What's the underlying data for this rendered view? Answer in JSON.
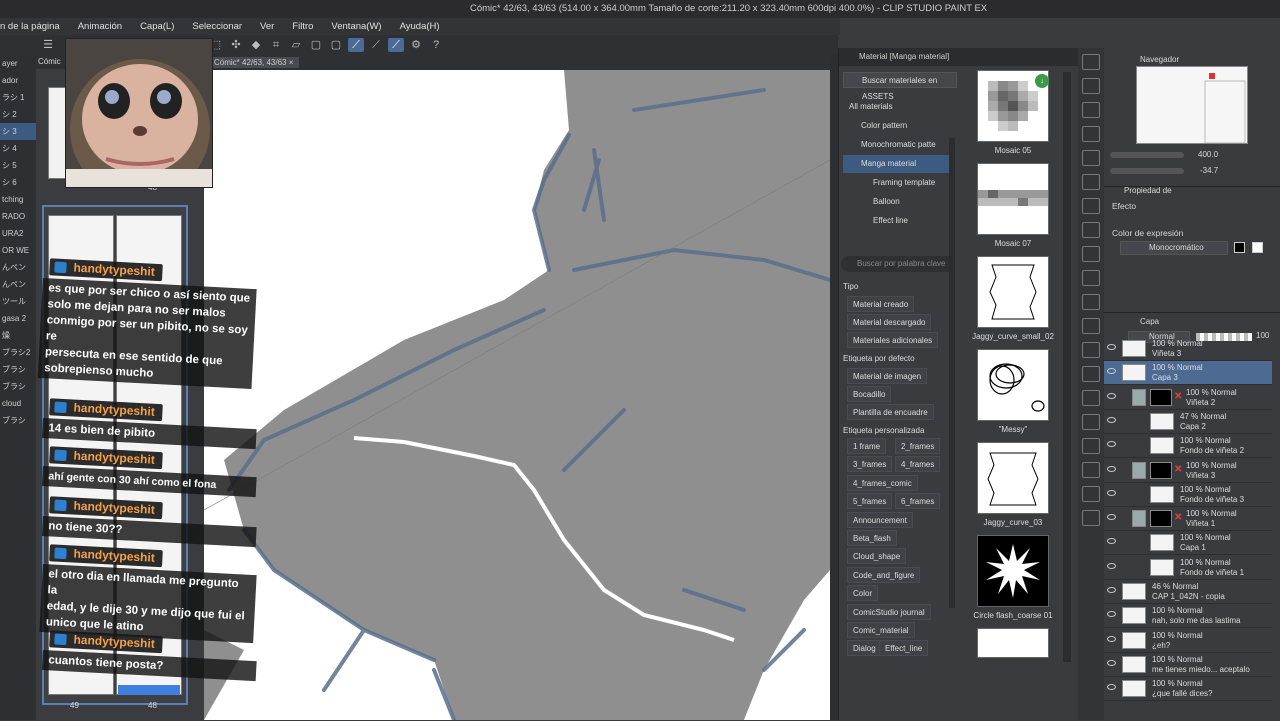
{
  "window": {
    "title": "Cómic* 42/63, 43/63 (514.00 x 364.00mm Tamaño de corte:211.20 x 323.40mm 600dpi 400.0%) - CLIP STUDIO PAINT EX"
  },
  "menu": [
    "n de la página",
    "Animación",
    "Capa(L)",
    "Seleccionar",
    "Ver",
    "Filtro",
    "Ventana(W)",
    "Ayuda(H)"
  ],
  "doc_tab": "Cómic* 42/63, 43/63",
  "pages_panel": {
    "tab": "Cómic",
    "numbers_top": [
      "48"
    ],
    "numbers_bottom": [
      "49",
      "48"
    ]
  },
  "left_strip": [
    "ayer",
    "ador",
    "ラシ 1",
    "シ 2",
    "シ 3",
    "シ 4",
    "シ 5",
    "シ 6",
    "tching",
    "RADO",
    "URA2",
    "OR WE",
    "んペン",
    "んペン",
    "ツール",
    "gasa 2",
    "燥",
    "ブラシ2",
    "ブラシ",
    "ブラシ",
    "cloud",
    "ブラシ"
  ],
  "chat": [
    {
      "user": "handytypeshit",
      "message": "es que por ser chico o así siento que\nsolo me dejan para no ser malos\nconmigo por ser un pibito, no se soy re\npersecuta en ese sentido de que\nsobrepienso mucho"
    },
    {
      "user": "handytypeshit",
      "message": "14 es bien de pibito"
    },
    {
      "user": "handytypeshit",
      "message": "ahí gente con 30 ahí como el fona"
    },
    {
      "user": "handytypeshit",
      "message": "no tiene 30??"
    },
    {
      "user": "handytypeshit",
      "message": "el otro dia en llamada me pregunto la\nedad, y le dije 30 y me dijo que fui el\nunico que le atino"
    },
    {
      "user": "handytypeshit",
      "message": "cuantos tiene posta?"
    }
  ],
  "material_panel": {
    "header": "Material [Manga material]",
    "assets_button": "Buscar materiales en ASSETS",
    "tree": [
      "All materials",
      "Color pattern",
      "Monochromatic patte",
      "Manga material",
      "Framing template",
      "Balloon",
      "Effect line"
    ],
    "search_placeholder": "Buscar por palabra clave",
    "tipo_label": "Tipo",
    "tipo": [
      "Material creado",
      "Material descargado",
      "Materiales adicionales"
    ],
    "default_label": "Etiqueta por defecto",
    "default_tags": [
      "Material de imagen",
      "Bocadillo",
      "Plantilla de encuadre"
    ],
    "custom_label": "Etiqueta personalizada",
    "custom_tags": [
      "1 frame",
      "2_frames",
      "3_frames",
      "4_frames",
      "4_frames_comic",
      "5_frames",
      "6_frames",
      "Announcement",
      "Beta_flash",
      "Cloud_shape",
      "Code_and_figure",
      "Color",
      "ComicStudio journal",
      "Comic_material",
      "Dialog",
      "Effect_line"
    ],
    "thumbnails": [
      "Mosaic 05",
      "Mosaic 07",
      "Jaggy_curve_small_02",
      "\"Messy\"",
      "Jaggy_curve_03",
      "Circle flash_coarse 01"
    ]
  },
  "navigator": {
    "title": "Navegador",
    "zoom": "400.0",
    "angle": "-34.7"
  },
  "properties": {
    "title": "Propiedad de",
    "effect_label": "Efecto",
    "expression_label": "Color de expresión",
    "expression_value": "Monocromático"
  },
  "layers": {
    "title": "Capa",
    "blend": "Normal",
    "opacity": "100",
    "items": [
      {
        "pct": "100 % Normal",
        "name": "Viñeta 3"
      },
      {
        "pct": "100 % Normal",
        "name": "Capa 3"
      },
      {
        "pct": "100 % Normal",
        "name": "Viñeta 2"
      },
      {
        "pct": "47 % Normal",
        "name": "Capa 2"
      },
      {
        "pct": "100 % Normal",
        "name": "Fondo de viñeta 2"
      },
      {
        "pct": "100 % Normal",
        "name": "Viñeta 3"
      },
      {
        "pct": "100 % Normal",
        "name": "Fondo de viñeta 3"
      },
      {
        "pct": "100 % Normal",
        "name": "Viñeta 1"
      },
      {
        "pct": "100 % Normal",
        "name": "Capa 1"
      },
      {
        "pct": "100 % Normal",
        "name": "Fondo de viñeta 1"
      },
      {
        "pct": "46 % Normal",
        "name": "CAP 1_042N - copia"
      },
      {
        "pct": "100 % Normal",
        "name": "nah, solo me das lastima"
      },
      {
        "pct": "100 % Normal",
        "name": "¿eh?"
      },
      {
        "pct": "100 % Normal",
        "name": "me tienes miedo... aceptalo"
      },
      {
        "pct": "100 % Normal",
        "name": "¿que fallé dices?"
      }
    ]
  },
  "colors": {
    "accent": "#3d5a80",
    "chat_name": "#f3a24a",
    "canvas_gray": "#8f8f8f",
    "stroke_blue": "#5a6f8c"
  }
}
